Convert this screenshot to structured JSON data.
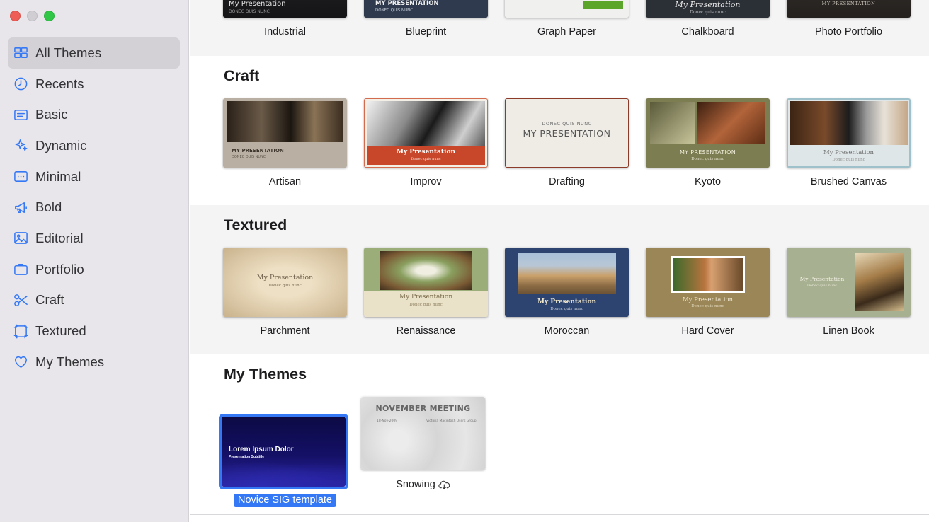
{
  "window": {
    "controls": [
      "close",
      "minimize",
      "zoom"
    ]
  },
  "sidebar": {
    "items": [
      {
        "label": "All Themes",
        "icon": "all-themes-icon",
        "active": true
      },
      {
        "label": "Recents",
        "icon": "clock-icon",
        "active": false
      },
      {
        "label": "Basic",
        "icon": "basic-icon",
        "active": false
      },
      {
        "label": "Dynamic",
        "icon": "sparkles-icon",
        "active": false
      },
      {
        "label": "Minimal",
        "icon": "minimal-icon",
        "active": false
      },
      {
        "label": "Bold",
        "icon": "megaphone-icon",
        "active": false
      },
      {
        "label": "Editorial",
        "icon": "photo-icon",
        "active": false
      },
      {
        "label": "Portfolio",
        "icon": "portfolio-icon",
        "active": false
      },
      {
        "label": "Craft",
        "icon": "scissors-icon",
        "active": false
      },
      {
        "label": "Textured",
        "icon": "textured-icon",
        "active": false
      },
      {
        "label": "My Themes",
        "icon": "heart-icon",
        "active": false
      }
    ],
    "accent_color": "#3478f6"
  },
  "top_row": {
    "tiles": [
      {
        "caption": "Industrial",
        "thumb_text": "My Presentation",
        "thumb_sub": "DONEC QUIS NUNC"
      },
      {
        "caption": "Blueprint",
        "thumb_text": "MY PRESENTATION",
        "thumb_sub": "DONEC QUIS NUNC"
      },
      {
        "caption": "Graph Paper",
        "thumb_text": "",
        "thumb_sub": ""
      },
      {
        "caption": "Chalkboard",
        "thumb_text": "My Presentation",
        "thumb_sub": "Donec quis nunc"
      },
      {
        "caption": "Photo Portfolio",
        "thumb_text": "MY PRESENTATION",
        "thumb_sub": ""
      }
    ]
  },
  "craft": {
    "title": "Craft",
    "tiles": [
      {
        "caption": "Artisan",
        "thumb_text": "MY PRESENTATION",
        "thumb_sub": "DONEC QUIS NUNC"
      },
      {
        "caption": "Improv",
        "thumb_text": "My Presentation",
        "thumb_sub": "Donec quis nunc"
      },
      {
        "caption": "Drafting",
        "thumb_text": "MY PRESENTATION",
        "thumb_sub": "DONEC QUIS NUNC"
      },
      {
        "caption": "Kyoto",
        "thumb_text": "MY PRESENTATION",
        "thumb_sub": "Donec quis nunc"
      },
      {
        "caption": "Brushed Canvas",
        "thumb_text": "My Presentation",
        "thumb_sub": "Donec quis nunc"
      }
    ]
  },
  "textured": {
    "title": "Textured",
    "tiles": [
      {
        "caption": "Parchment",
        "thumb_text": "My Presentation",
        "thumb_sub": "Donec quis nunc"
      },
      {
        "caption": "Renaissance",
        "thumb_text": "My Presentation",
        "thumb_sub": "Donec quis nunc"
      },
      {
        "caption": "Moroccan",
        "thumb_text": "My Presentation",
        "thumb_sub": "Donec quis nunc"
      },
      {
        "caption": "Hard Cover",
        "thumb_text": "My Presentation",
        "thumb_sub": "Donec quis nunc"
      },
      {
        "caption": "Linen Book",
        "thumb_text": "My Presentation",
        "thumb_sub": "Donec quis nunc"
      }
    ]
  },
  "my_themes": {
    "title": "My Themes",
    "tiles": [
      {
        "caption": "Novice SIG template",
        "thumb_text": "Lorem Ipsum Dolor",
        "thumb_sub": "Presentation Subtitle",
        "selected": true
      },
      {
        "caption": "Snowing",
        "thumb_text": "NOVEMBER MEETING",
        "thumb_sub": "18-Nov-2009",
        "thumb_sub2": "Victoria Macintosh Users Group",
        "cloud_icon": "cloud-download-icon",
        "selected": false
      }
    ]
  }
}
